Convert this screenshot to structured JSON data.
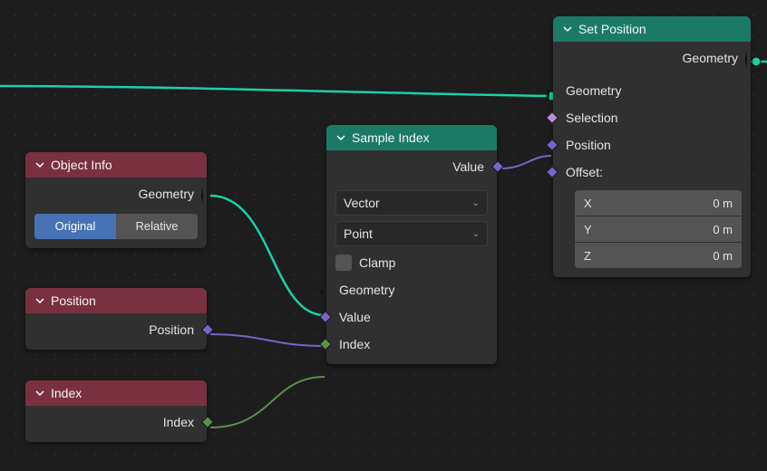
{
  "nodes": {
    "object_info": {
      "title": "Object Info",
      "geometry_label": "Geometry",
      "toggle": {
        "original": "Original",
        "relative": "Relative"
      }
    },
    "position": {
      "title": "Position",
      "output_label": "Position"
    },
    "index": {
      "title": "Index",
      "output_label": "Index"
    },
    "sample_index": {
      "title": "Sample Index",
      "value_out_label": "Value",
      "data_type": "Vector",
      "domain": "Point",
      "clamp_label": "Clamp",
      "geometry_in_label": "Geometry",
      "value_in_label": "Value",
      "index_in_label": "Index"
    },
    "set_position": {
      "title": "Set Position",
      "geometry_out_label": "Geometry",
      "geometry_in_label": "Geometry",
      "selection_label": "Selection",
      "position_label": "Position",
      "offset_label": "Offset:",
      "offset": {
        "x_label": "X",
        "y_label": "Y",
        "z_label": "Z",
        "x": "0 m",
        "y": "0 m",
        "z": "0 m"
      }
    }
  }
}
